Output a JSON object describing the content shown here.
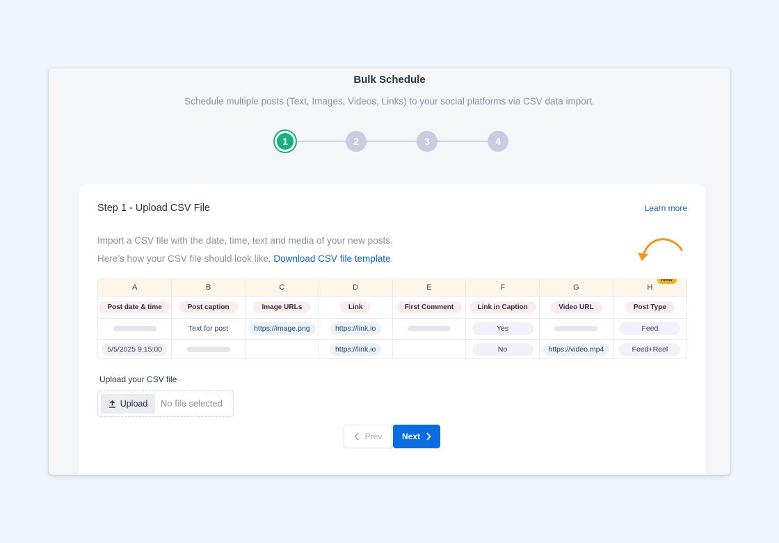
{
  "header": {
    "title": "Bulk Schedule",
    "subtitle": "Schedule multiple posts (Text, Images, Videos, Links) to your social platforms via CSV data import."
  },
  "stepper": {
    "steps": [
      "1",
      "2",
      "3",
      "4"
    ],
    "active": 1
  },
  "card": {
    "title": "Step 1 - Upload CSV File",
    "learn_more": "Learn more",
    "intro_line1": "Import a CSV file with the date, time, text and media of your new posts.",
    "intro_line2": "Here’s how your CSV file should look like.",
    "download_link": "Download CSV file template",
    "intro_period": "."
  },
  "csv_example": {
    "columns": [
      "A",
      "B",
      "C",
      "D",
      "E",
      "F",
      "G",
      "H"
    ],
    "new_badge": "New",
    "headers": [
      "Post date & time",
      "Post caption",
      "Image URLs",
      "Link",
      "First Comment",
      "Link in Caption",
      "Video URL",
      "Post Type"
    ],
    "row1": {
      "caption": "Text for post",
      "image": "https://image.png",
      "link": "https://link.io",
      "link_in_caption": "Yes",
      "post_type": "Feed"
    },
    "row2": {
      "date": "5/5/2025 9:15:00",
      "link": "https://link.io",
      "link_in_caption": "No",
      "video": "https://video.mp4",
      "post_type": "Feed+Reel"
    }
  },
  "upload": {
    "label": "Upload your CSV file",
    "button": "Upload",
    "status": "No file selected"
  },
  "nav": {
    "prev": "Prev",
    "next": "Next"
  },
  "colors": {
    "accent": "#0b6be0",
    "active_step": "#14b37d",
    "arrow": "#f5931f",
    "badge": "#f5b31b"
  },
  "icons": [
    "upload-icon",
    "chevron-left-icon",
    "chevron-right-icon",
    "curved-arrow-icon"
  ]
}
